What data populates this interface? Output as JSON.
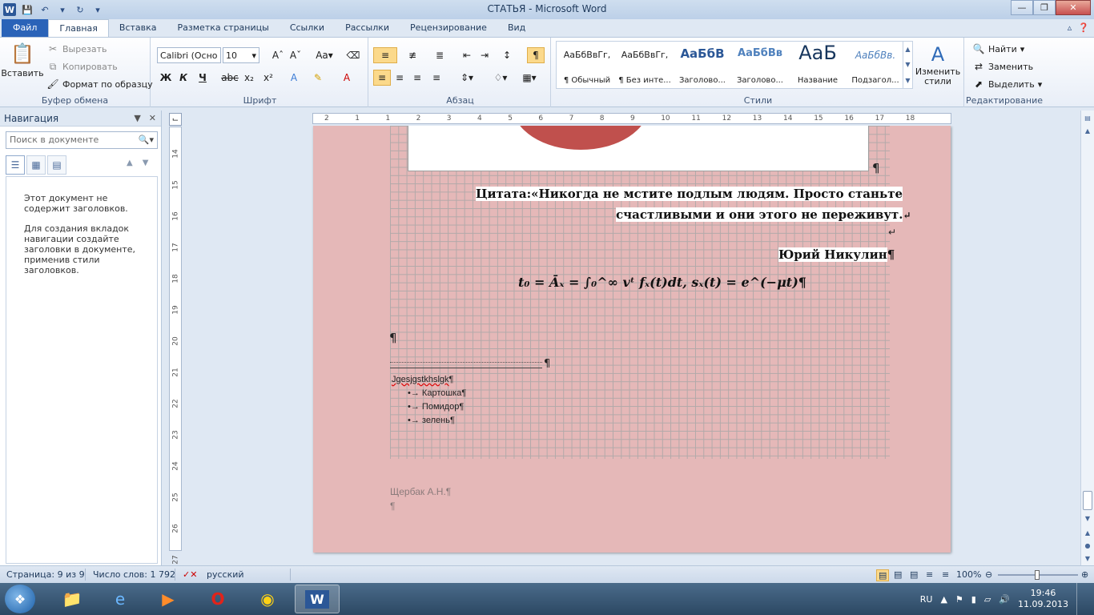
{
  "window": {
    "title": "СТАТЬЯ - Microsoft Word"
  },
  "tabs": [
    {
      "label": "Файл"
    },
    {
      "label": "Главная"
    },
    {
      "label": "Вставка"
    },
    {
      "label": "Разметка страницы"
    },
    {
      "label": "Ссылки"
    },
    {
      "label": "Рассылки"
    },
    {
      "label": "Рецензирование"
    },
    {
      "label": "Вид"
    }
  ],
  "ribbon": {
    "clipboard": {
      "label": "Буфер обмена",
      "paste": "Вставить",
      "cut": "Вырезать",
      "copy": "Копировать",
      "format_painter": "Формат по образцу"
    },
    "font": {
      "label": "Шрифт",
      "font_name": "Calibri (Осно",
      "font_size": "10"
    },
    "paragraph": {
      "label": "Абзац"
    },
    "styles": {
      "label": "Стили",
      "items": [
        {
          "sample": "АаБбВвГг,",
          "name": "¶ Обычный"
        },
        {
          "sample": "АаБбВвГг,",
          "name": "¶ Без инте..."
        },
        {
          "sample": "АаБбВ",
          "name": "Заголово..."
        },
        {
          "sample": "АаБбВв",
          "name": "Заголово..."
        },
        {
          "sample": "АаБ",
          "name": "Название"
        },
        {
          "sample": "АаБбВв.",
          "name": "Подзагол..."
        }
      ],
      "change_styles": "Изменить стили"
    },
    "editing": {
      "label": "Редактирование",
      "find": "Найти",
      "replace": "Заменить",
      "select": "Выделить"
    }
  },
  "nav": {
    "title": "Навигация",
    "search_placeholder": "Поиск в документе",
    "no_headings": "Этот документ не содержит заголовков.",
    "hint": "Для создания вкладок навигации создайте заголовки в документе, применив стили заголовков."
  },
  "ruler": {
    "h_ticks": [
      "2",
      "1",
      "1",
      "2",
      "3",
      "4",
      "5",
      "6",
      "7",
      "8",
      "9",
      "10",
      "11",
      "12",
      "13",
      "14",
      "15",
      "16",
      "17",
      "18"
    ],
    "v_ticks": [
      "14",
      "15",
      "16",
      "17",
      "18",
      "19",
      "20",
      "21",
      "22",
      "23",
      "24",
      "25",
      "26",
      "27"
    ]
  },
  "document": {
    "quote_line1": "Цитата:«Никогда не мстите подлым людям. Просто станьте",
    "quote_line2": "счастливыми и они этого не переживут.",
    "author": "Юрий Никулин",
    "formula": "t₀ = Āₓ = ∫₀^∞ vᵗ fₓ(t)dt, sₓ(t) = e^(−μt)",
    "misc_text": "Jgesjgstkhslgk",
    "list": [
      "Картошка",
      "Помидор",
      "зелень"
    ],
    "footer_name": "Щербак А.Н.",
    "para_mark": "¶"
  },
  "status": {
    "page": "Страница: 9 из 9",
    "words": "Число слов: 1 792",
    "language": "русский",
    "zoom": "100%"
  },
  "taskbar": {
    "lang": "RU",
    "time": "19:46",
    "date": "11.09.2013"
  }
}
